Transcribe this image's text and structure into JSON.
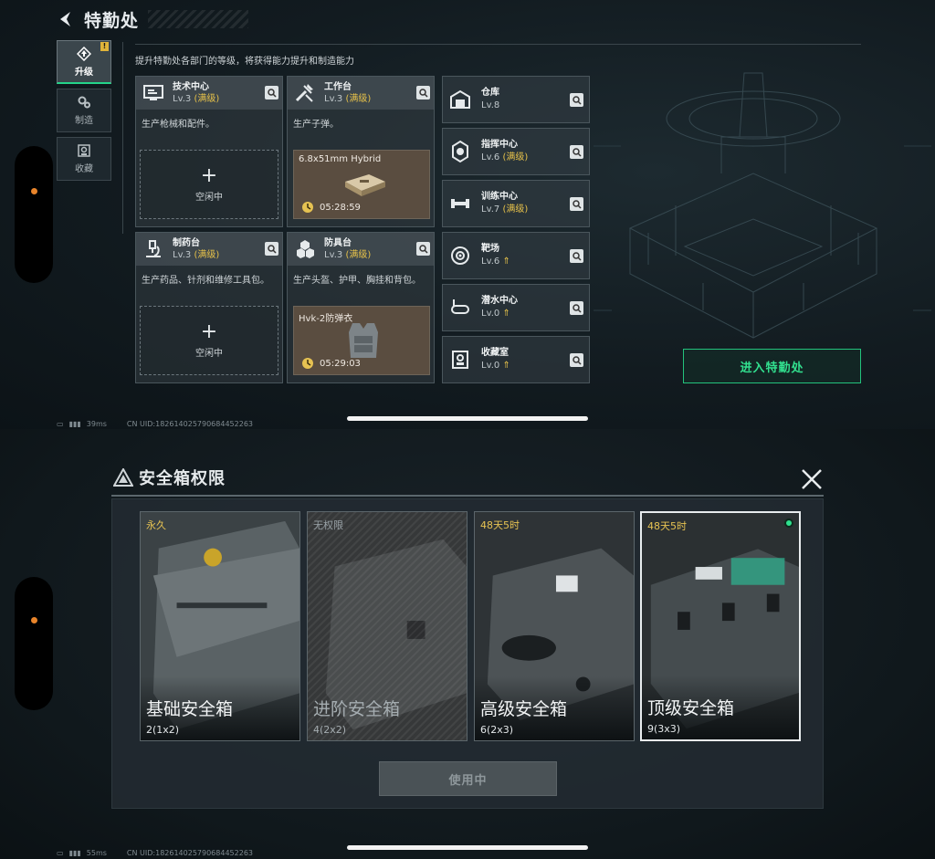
{
  "top": {
    "title": "特勤处",
    "description": "提升特勤处各部门的等级，将获得能力提升和制造能力",
    "tabs": [
      {
        "label": "升级",
        "icon": "upgrade-icon",
        "active": true,
        "alert": "!"
      },
      {
        "label": "制造",
        "icon": "gears-icon",
        "active": false
      },
      {
        "label": "收藏",
        "icon": "collection-icon",
        "active": false
      }
    ],
    "workshops": [
      {
        "name": "技术中心",
        "level": "Lv.3",
        "max": "(满级)",
        "desc": "生产枪械和配件。",
        "slot": "idle",
        "idle_label": "空闲中",
        "icon": "monitor-icon"
      },
      {
        "name": "工作台",
        "level": "Lv.3",
        "max": "(满级)",
        "desc": "生产子弹。",
        "slot": "producing",
        "product": "6.8x51mm Hybrid",
        "time": "05:28:59",
        "icon": "tools-icon"
      },
      {
        "name": "制药台",
        "level": "Lv.3",
        "max": "(满级)",
        "desc": "生产药品、针剂和维修工具包。",
        "slot": "idle",
        "idle_label": "空闲中",
        "icon": "microscope-icon"
      },
      {
        "name": "防具台",
        "level": "Lv.3",
        "max": "(满级)",
        "desc": "生产头盔、护甲、胸挂和背包。",
        "slot": "producing",
        "product": "Hvk-2防弹衣",
        "time": "05:29:03",
        "icon": "armor-icon"
      }
    ],
    "rooms": [
      {
        "name": "仓库",
        "level": "Lv.8",
        "max": "",
        "upgrade": false,
        "icon": "warehouse-icon"
      },
      {
        "name": "指挥中心",
        "level": "Lv.6",
        "max": "(满级)",
        "upgrade": false,
        "icon": "command-icon"
      },
      {
        "name": "训练中心",
        "level": "Lv.7",
        "max": "(满级)",
        "upgrade": false,
        "icon": "dumbbell-icon"
      },
      {
        "name": "靶场",
        "level": "Lv.6",
        "max": "",
        "upgrade": true,
        "icon": "target-icon"
      },
      {
        "name": "潜水中心",
        "level": "Lv.0",
        "max": "",
        "upgrade": true,
        "icon": "diving-icon"
      },
      {
        "name": "收藏室",
        "level": "Lv.0",
        "max": "",
        "upgrade": true,
        "icon": "vault-icon"
      }
    ],
    "enter_label": "进入特勤处",
    "status": {
      "ping": "39ms",
      "uid": "CN UID:1826140257906844522​63"
    }
  },
  "bottom": {
    "title": "安全箱权限",
    "boxes": [
      {
        "duration": "永久",
        "name": "基础安全箱",
        "size": "2(1x2)",
        "locked": false,
        "selected": false
      },
      {
        "duration": "无权限",
        "name": "进阶安全箱",
        "size": "4(2x2)",
        "locked": true,
        "selected": false
      },
      {
        "duration": "48天5时",
        "name": "高级安全箱",
        "size": "6(2x3)",
        "locked": false,
        "selected": false
      },
      {
        "duration": "48天5时",
        "name": "顶级安全箱",
        "size": "9(3x3)",
        "locked": false,
        "selected": true
      }
    ],
    "use_label": "使用中",
    "status": {
      "ping": "55ms",
      "uid": "CN UID:182614025790684452263"
    }
  },
  "colors": {
    "accent_green": "#32e08f",
    "max_gold": "#e7c24a",
    "bg": "#0d1418"
  }
}
